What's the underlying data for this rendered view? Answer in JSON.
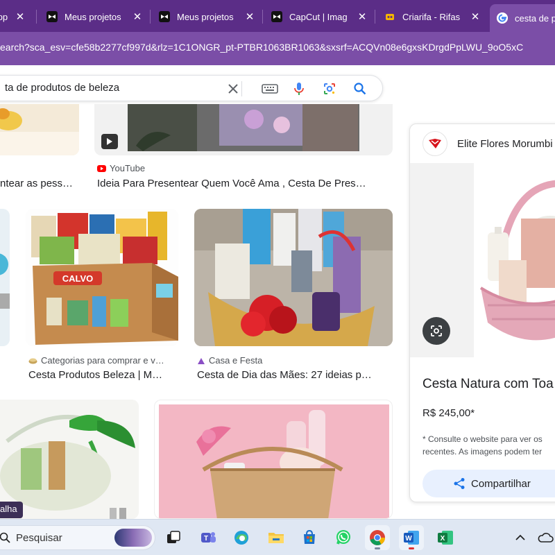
{
  "tabs": [
    {
      "title": "App",
      "favicon": "app-icon"
    },
    {
      "title": "Meus projetos",
      "favicon": "capcut-icon"
    },
    {
      "title": "Meus projetos",
      "favicon": "capcut-icon"
    },
    {
      "title": "CapCut | Imag",
      "favicon": "capcut-icon"
    },
    {
      "title": "Criarifa - Rifas",
      "favicon": "criarifa-icon"
    },
    {
      "title": "cesta de p",
      "favicon": "google-icon"
    }
  ],
  "close_glyph": "✕",
  "url": "earch?sca_esv=cfe58b2277cf997d&rlz=1C1ONGR_pt-PTBR1063BR1063&sxsrf=ACQVn08e6gxsKDrgdPpLWU_9oO5xC",
  "search": {
    "value": "ta de produtos de beleza"
  },
  "results": {
    "r1": {
      "source": "",
      "title": "ntear as pess…"
    },
    "r2": {
      "source": "YouTube",
      "title": "Ideia Para Presentear Quem Você Ama , Cesta De Pres…"
    },
    "r3": {
      "source": "",
      "title": ""
    },
    "r4": {
      "source": "Categorias para comprar e v…",
      "title": "Cesta Produtos Beleza | M…"
    },
    "r5": {
      "source": "Casa e Festa",
      "title": "Cesta de Dia das Mães: 27 ideias p…"
    },
    "r6": {
      "badge": "alha"
    }
  },
  "panel": {
    "site": "Elite Flores Morumbi",
    "title": "Cesta Natura com Toa",
    "price": "R$ 245,00*",
    "note_line1": "* Consulte o website para ver os",
    "note_line2": "recentes. As imagens podem ter",
    "share_label": "Compartilhar"
  },
  "taskbar": {
    "search_label": "Pesquisar"
  },
  "colors": {
    "tabbar": "#5b2d87",
    "addrbar": "#7b4ea7",
    "link_blue": "#1a73e8"
  }
}
